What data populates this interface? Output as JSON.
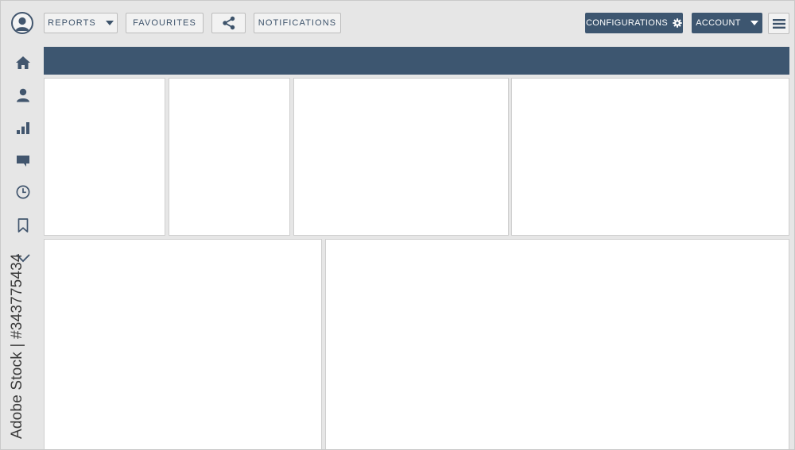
{
  "toolbar": {
    "reports_label": "REPORTS",
    "favourites_label": "FAVOURITES",
    "notifications_label": "NOTIFICATIONS",
    "configurations_label": "CONFIGURATIONS",
    "account_label": "ACCOUNT"
  },
  "icons": {
    "avatar": "user-avatar-icon",
    "share": "share-icon",
    "configurations": "gear-icon",
    "menu": "hamburger-menu-icon",
    "sidebar": [
      "home-icon",
      "user-icon",
      "bar-chart-icon",
      "chat-icon",
      "clock-icon",
      "bookmark-icon",
      "chevron-down-icon"
    ]
  },
  "colors": {
    "accent": "#3d5670",
    "background": "#e6e6e6",
    "panel": "#ffffff",
    "icon": "#42566e"
  },
  "watermark": {
    "stock_text": "Adobe Stock | #343775434"
  }
}
